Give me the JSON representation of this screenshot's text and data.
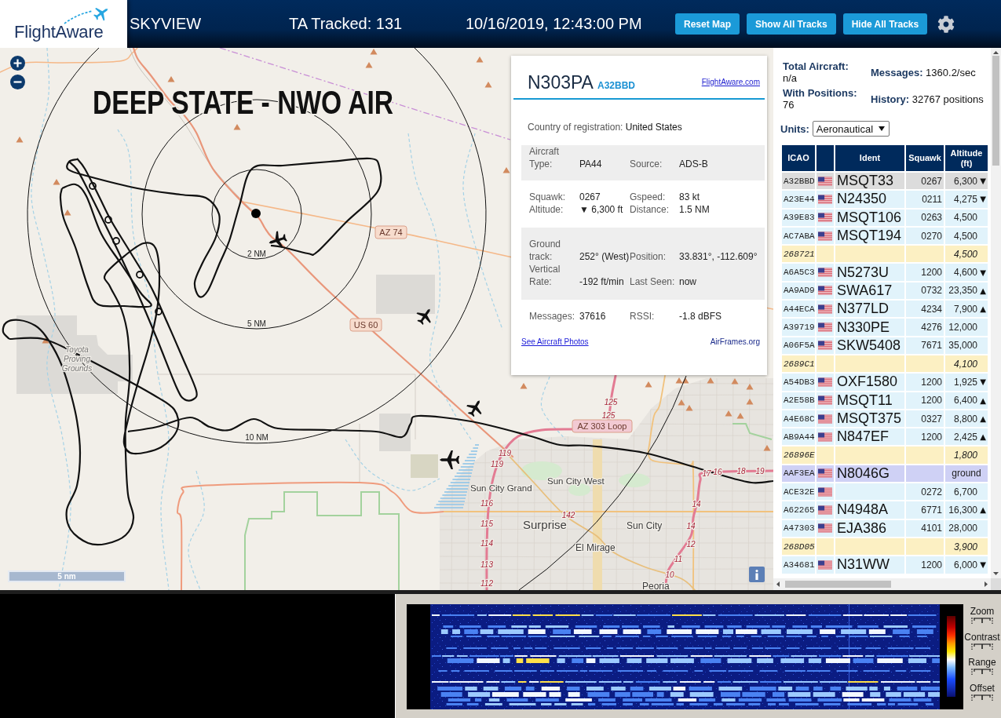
{
  "header": {
    "logo": "FlightAware",
    "title": "SKYVIEW",
    "tracked": "TA Tracked: 131",
    "datetime": "10/16/2019, 12:43:00 PM",
    "buttons": [
      "Reset Map",
      "Show All Tracks",
      "Hide All Tracks"
    ]
  },
  "map": {
    "overlay_title": "DEEP STATE - NWO AIR",
    "ring_labels": [
      "2 NM",
      "5 NM",
      "10 NM"
    ],
    "route_shields": [
      {
        "text": "AZ 74",
        "color": "#f7dccd"
      },
      {
        "text": "US 60",
        "color": "#f7dccd"
      },
      {
        "text": "AZ 303 Loop",
        "color": "#f2cad3"
      }
    ],
    "place_labels": [
      "Toyota Proving Grounds",
      "Sun City West",
      "Sun City Grand",
      "Surprise",
      "Sun City",
      "El Mirage",
      "Peoria"
    ],
    "road_numbers": [
      "125",
      "125",
      "119",
      "119",
      "17",
      "16",
      "18",
      "19",
      "116",
      "14",
      "142",
      "115",
      "14",
      "114",
      "12",
      "11",
      "113",
      "112",
      "10"
    ],
    "scale": "5 nm"
  },
  "popup": {
    "registration": "N303PA",
    "hex": "A32BBD",
    "link": "FlightAware.com",
    "country_label": "Country of registration:",
    "country": "United States",
    "sections": [
      {
        "rows": [
          [
            {
              "label": "Aircraft Type:",
              "value": "PA44"
            },
            {
              "label": "Source:",
              "value": "ADS-B"
            }
          ]
        ]
      },
      {
        "rows": [
          [
            {
              "label": "Squawk:",
              "value": "0267"
            },
            {
              "label": "Gspeed:",
              "value": "83 kt"
            }
          ],
          [
            {
              "label": "Altitude:",
              "value": "▼ 6,300 ft"
            },
            {
              "label": "Distance:",
              "value": "1.5 NM"
            }
          ]
        ]
      },
      {
        "rows": [
          [
            {
              "label": "Ground track:",
              "value": "252° (West)"
            },
            {
              "label": "Position:",
              "value": "33.831°, -112.609°"
            }
          ],
          [
            {
              "label": "Vertical Rate:",
              "value": "-192 ft/min"
            },
            {
              "label": "Last Seen:",
              "value": "now"
            }
          ]
        ]
      },
      {
        "rows": [
          [
            {
              "label": "Messages:",
              "value": "37616"
            },
            {
              "label": "RSSI:",
              "value": "-1.8 dBFS"
            }
          ]
        ]
      }
    ],
    "links": [
      "See Aircraft Photos",
      "AirFrames.org"
    ]
  },
  "sidebar": {
    "stats": [
      {
        "label": "Total Aircraft:",
        "value": "n/a"
      },
      {
        "label": "Messages:",
        "value": "1360.2/sec"
      },
      {
        "label": "With Positions:",
        "value": "76"
      },
      {
        "label": "History:",
        "value": "32767 positions"
      }
    ],
    "units": {
      "label": "Units:",
      "value": "Aeronautical"
    }
  },
  "aircraft_table": {
    "columns": [
      {
        "kind": "text",
        "label": "ICAO"
      },
      {
        "kind": "blank"
      },
      {
        "kind": "text",
        "label": "Ident"
      },
      {
        "kind": "text",
        "label": "Squawk"
      },
      {
        "kind": "text",
        "label": "Altitude (ft)"
      }
    ],
    "rows": [
      {
        "icao": "A32BBD",
        "flag": true,
        "ident": "MSQT33",
        "squawk": "0267",
        "altitude": "6,300",
        "trend": "▼",
        "kind": "standard",
        "selected": true
      },
      {
        "icao": "A23E44",
        "flag": true,
        "ident": "N24350",
        "squawk": "0211",
        "altitude": "4,275",
        "trend": "▼",
        "kind": "standard",
        "selected": false
      },
      {
        "icao": "A39E83",
        "flag": true,
        "ident": "MSQT106",
        "squawk": "0263",
        "altitude": "4,500",
        "kind": "standard",
        "selected": false
      },
      {
        "icao": "AC7ABA",
        "flag": true,
        "ident": "MSQT194",
        "squawk": "0270",
        "altitude": "4,500",
        "kind": "standard",
        "selected": false
      },
      {
        "icao": "268721",
        "flag": false,
        "altitude": "4,500",
        "kind": "other",
        "selected": false
      },
      {
        "icao": "A6A5C3",
        "flag": true,
        "ident": "N5273U",
        "squawk": "1200",
        "altitude": "4,600",
        "trend": "▼",
        "kind": "standard",
        "selected": false
      },
      {
        "icao": "AA9AD9",
        "flag": true,
        "ident": "SWA617",
        "squawk": "0732",
        "altitude": "23,350",
        "trend": "▲",
        "kind": "standard",
        "selected": false
      },
      {
        "icao": "A44ECA",
        "flag": true,
        "ident": "N377LD",
        "squawk": "4234",
        "altitude": "7,900",
        "trend": "▲",
        "kind": "standard",
        "selected": false
      },
      {
        "icao": "A39719",
        "flag": true,
        "ident": "N330PE",
        "squawk": "4276",
        "altitude": "12,000",
        "kind": "standard",
        "selected": false
      },
      {
        "icao": "A06F5A",
        "flag": true,
        "ident": "SKW5408",
        "squawk": "7671",
        "altitude": "35,000",
        "kind": "standard",
        "selected": false
      },
      {
        "icao": "2689C1",
        "flag": false,
        "altitude": "4,100",
        "kind": "other",
        "selected": false
      },
      {
        "icao": "A54DB3",
        "flag": true,
        "ident": "OXF1580",
        "squawk": "1200",
        "altitude": "1,925",
        "trend": "▼",
        "kind": "standard",
        "selected": false
      },
      {
        "icao": "A2E58B",
        "flag": true,
        "ident": "MSQT11",
        "squawk": "1200",
        "altitude": "6,400",
        "trend": "▲",
        "kind": "standard",
        "selected": false
      },
      {
        "icao": "A4E68C",
        "flag": true,
        "ident": "MSQT375",
        "squawk": "0327",
        "altitude": "8,800",
        "trend": "▲",
        "kind": "standard",
        "selected": false
      },
      {
        "icao": "AB9A44",
        "flag": true,
        "ident": "N847EF",
        "squawk": "1200",
        "altitude": "2,425",
        "trend": "▲",
        "kind": "standard",
        "selected": false
      },
      {
        "icao": "26896E",
        "flag": false,
        "altitude": "1,800",
        "kind": "other",
        "selected": false
      },
      {
        "icao": "AAF3EA",
        "flag": true,
        "ident": "N8046G",
        "altitude": "ground",
        "kind": "ground",
        "selected": false
      },
      {
        "icao": "ACE32E",
        "flag": true,
        "squawk": "0272",
        "altitude": "6,700",
        "kind": "standard",
        "selected": false
      },
      {
        "icao": "A62265",
        "flag": true,
        "ident": "N4948A",
        "squawk": "6771",
        "altitude": "16,300",
        "trend": "▲",
        "kind": "standard",
        "selected": false
      },
      {
        "icao": "A47303",
        "flag": true,
        "ident": "EJA386",
        "squawk": "4101",
        "altitude": "28,000",
        "kind": "standard",
        "selected": false
      },
      {
        "icao": "268D05",
        "flag": false,
        "altitude": "3,900",
        "kind": "other",
        "selected": false
      },
      {
        "icao": "A34681",
        "flag": true,
        "ident": "N31WW",
        "squawk": "1200",
        "altitude": "6,000",
        "trend": "▼",
        "kind": "standard",
        "selected": false
      }
    ]
  },
  "waterfall": {
    "controls": [
      "Zoom",
      "Contrast",
      "Range",
      "Offset"
    ]
  }
}
